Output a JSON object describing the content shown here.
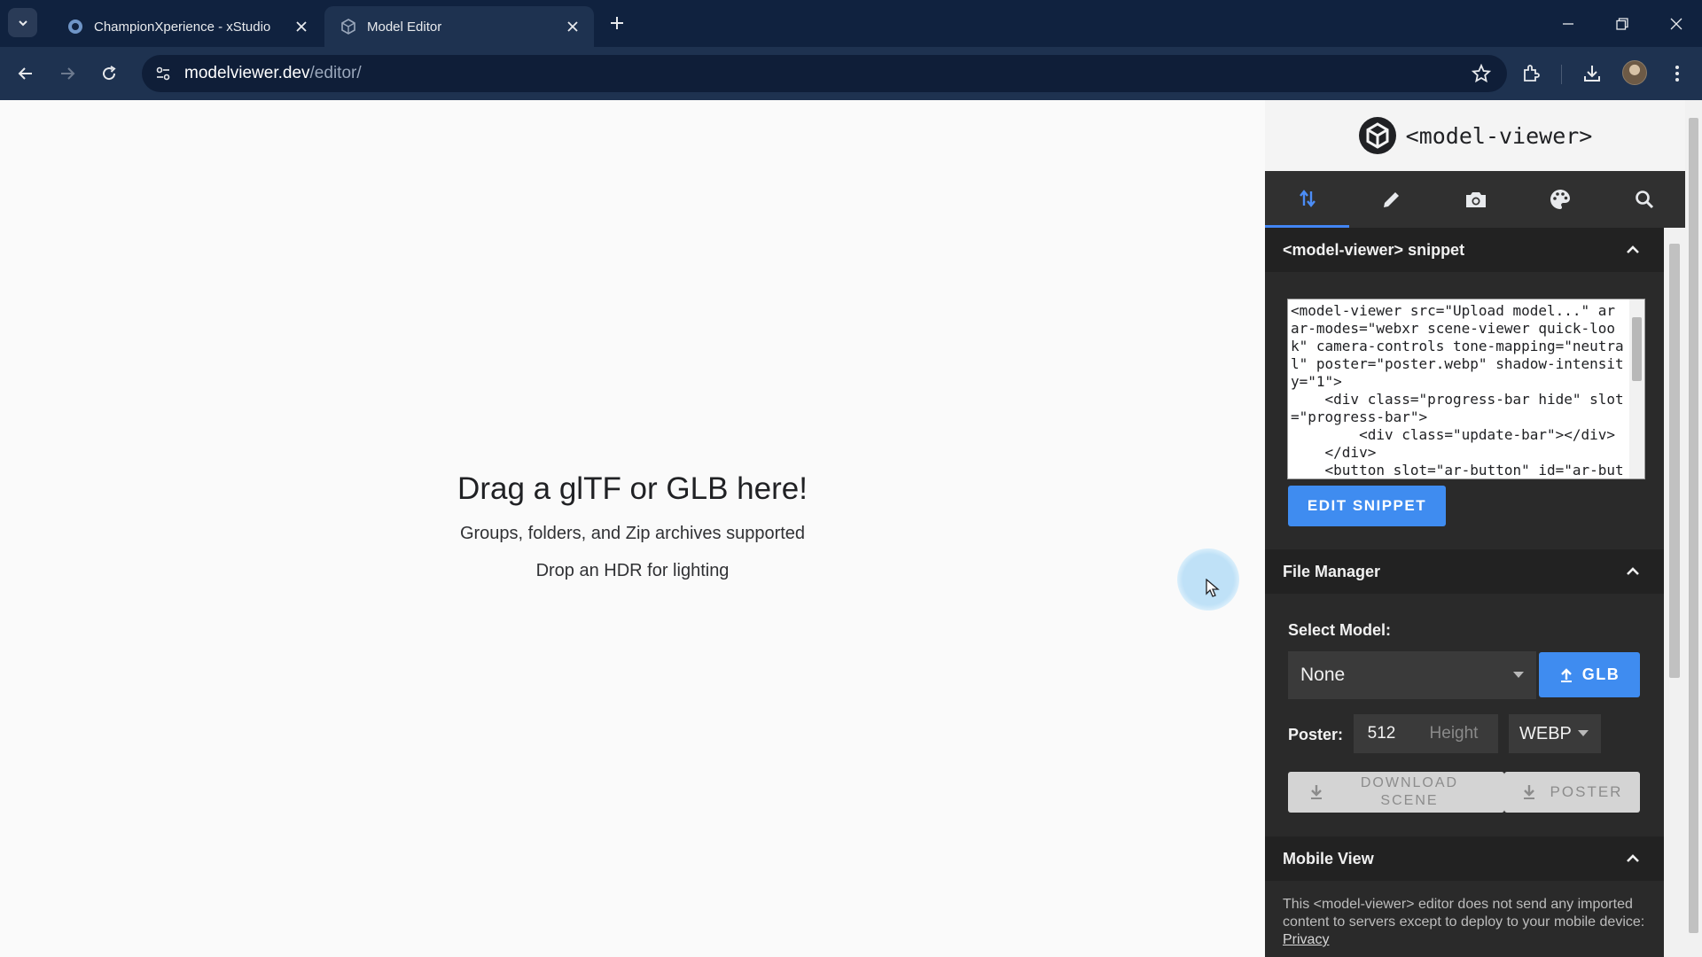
{
  "browser": {
    "tabs": [
      {
        "title": "ChampionXperience - xStudio",
        "active": false
      },
      {
        "title": "Model Editor",
        "active": true
      }
    ],
    "url_host": "modelviewer.dev",
    "url_path": "/editor/"
  },
  "viewer": {
    "title": "Drag a glTF or GLB here!",
    "subtitle_1": "Groups, folders, and Zip archives supported",
    "subtitle_2": "Drop an HDR for lighting"
  },
  "panel": {
    "brand": "<model-viewer>",
    "tabs": [
      "upload-download-icon",
      "pencil-icon",
      "camera-icon",
      "palette-icon",
      "search-icon"
    ],
    "snippet_section": {
      "title": "<model-viewer> snippet",
      "code": "<model-viewer src=\"Upload model...\" ar ar-modes=\"webxr scene-viewer quick-look\" camera-controls tone-mapping=\"neutral\" poster=\"poster.webp\" shadow-intensity=\"1\">\n    <div class=\"progress-bar hide\" slot=\"progress-bar\">\n        <div class=\"update-bar\"></div>\n    </div>\n    <button slot=\"ar-button\" id=\"ar-button\">",
      "edit_button": "EDIT SNIPPET"
    },
    "file_manager": {
      "title": "File Manager",
      "select_model_label": "Select Model:",
      "select_model_value": "None",
      "glb_button": "GLB",
      "poster_label": "Poster:",
      "poster_width": "512",
      "poster_height_placeholder": "Height",
      "poster_format": "WEBP",
      "download_scene_line1": "DOWNLOAD",
      "download_scene_line2": "SCENE",
      "poster_button": "POSTER"
    },
    "mobile_view": {
      "title": "Mobile View"
    },
    "footer": {
      "text": "This <model-viewer> editor does not send any imported content to servers except to deploy to your mobile device: ",
      "link": "Privacy"
    }
  },
  "colors": {
    "tabbar": "#10223f",
    "toolbar": "#1e3250",
    "accent_blue": "#3f8cf0",
    "panel_bg": "#2a2a2a"
  }
}
